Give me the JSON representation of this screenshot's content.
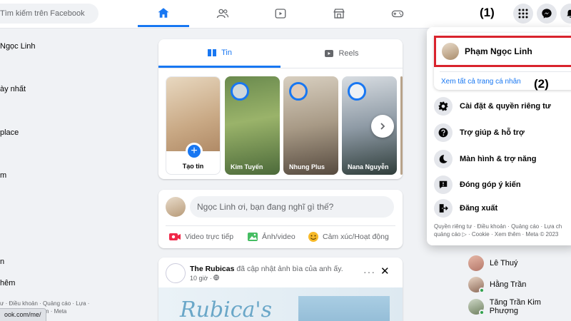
{
  "search": {
    "placeholder": "Tìm kiếm trên Facebook"
  },
  "nav": {
    "tabs": [
      {
        "name": "home",
        "active": true
      },
      {
        "name": "friends",
        "active": false
      },
      {
        "name": "watch",
        "active": false
      },
      {
        "name": "marketplace",
        "active": false
      },
      {
        "name": "gaming",
        "active": false
      }
    ]
  },
  "annotations": {
    "one": "(1)",
    "two": "(2)"
  },
  "sidebar": {
    "items": [
      "Ngọc Linh",
      "ày nhất",
      "place",
      "m",
      "n",
      "hêm"
    ],
    "footer": "ư · Điều khoản · Quảng cáo · Lựa · Cookie · Xem thêm · Meta"
  },
  "status_bar": {
    "url": "ook.com/me/"
  },
  "stories": {
    "tabs": {
      "tin": "Tin",
      "reels": "Reels"
    },
    "create_label": "Tạo tin",
    "create_plus": "+",
    "items": [
      {
        "name": "Kim Tuyến"
      },
      {
        "name": "Nhung Plus"
      },
      {
        "name": "Nana Nguyễn"
      }
    ]
  },
  "composer": {
    "placeholder": "Ngọc Linh ơi, bạn đang nghĩ gì thế?",
    "actions": {
      "live": "Video trực tiếp",
      "photo": "Ảnh/video",
      "feeling": "Cảm xúc/Hoạt động"
    }
  },
  "post": {
    "author": "The Rubicas",
    "action": "đã cập nhật ảnh bìa của anh ấy.",
    "time": "10 giờ ·",
    "more": "···",
    "close": "✕",
    "banner_text": "Rubica's"
  },
  "menu": {
    "profile_name": "Phạm Ngọc Linh",
    "see_all": "Xem tất cả trang cá nhân",
    "items": {
      "settings": "Cài đặt & quyền riêng tư",
      "help": "Trợ giúp & hỗ trợ",
      "display": "Màn hình & trợ năng",
      "feedback": "Đóng góp ý kiến",
      "logout": "Đăng xuất"
    },
    "footer_1": "Quyền riêng tư · Điều khoản · Quảng cáo · Lựa ch",
    "footer_2": "quảng cáo ▷ · Cookie · Xem thêm · Meta © 2023"
  },
  "contacts": [
    {
      "name": "Lê Thuý",
      "online": false
    },
    {
      "name": "Hằng Trần",
      "online": true
    },
    {
      "name": "Tăng Trần Kim Phượng",
      "online": true
    }
  ],
  "colors": {
    "accent": "#1877f2",
    "highlight_box": "#d9232d",
    "online": "#31a24c"
  }
}
